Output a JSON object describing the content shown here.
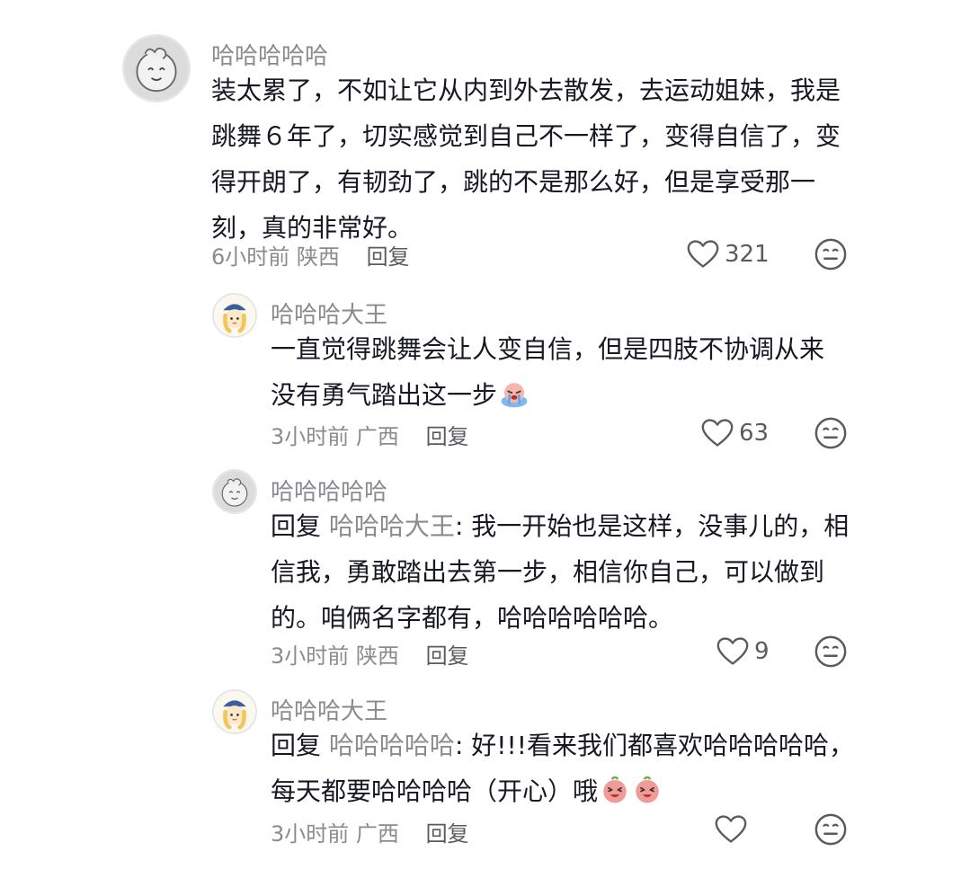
{
  "comments": [
    {
      "username": "哈哈哈哈哈",
      "lines": [
        "装太累了，不如让它从内到外去散发，去运动姐妹，我是",
        "跳舞６年了，切实感觉到自己不一样了，变得自信了，变",
        "得开朗了，有韧劲了，跳的不是那么好，但是享受那一",
        "刻，真的非常好。"
      ],
      "time": "6小时前",
      "location": "陕西",
      "reply_label": "回复",
      "likes": "321"
    },
    {
      "username": "哈哈哈大王",
      "lines": [
        "一直觉得跳舞会让人变自信，但是四肢不协调从来",
        "没有勇气踏出这一步"
      ],
      "time": "3小时前",
      "location": "广西",
      "reply_label": "回复",
      "likes": "63"
    },
    {
      "username": "哈哈哈哈哈",
      "reply_prefix": "回复",
      "mention": "哈哈哈大王",
      "lines": [
        ": 我一开始也是这样，没事儿的，相",
        "信我，勇敢踏出去第一步，相信你自己，可以做到",
        "的。咱俩名字都有，哈哈哈哈哈哈。"
      ],
      "time": "3小时前",
      "location": "陕西",
      "reply_label": "回复",
      "likes": "9"
    },
    {
      "username": "哈哈哈大王",
      "reply_prefix": "回复",
      "mention": "哈哈哈哈哈",
      "lines": [
        ": 好!!!看来我们都喜欢哈哈哈哈哈，",
        "每天都要哈哈哈哈（开心）哦"
      ],
      "time": "3小时前",
      "location": "广西",
      "reply_label": "回复",
      "likes": ""
    }
  ],
  "icons": {
    "like": "heart-outline-icon",
    "dislike": "neutral-face-icon",
    "crying": "crying-emoji",
    "happy": "laughing-emoji"
  },
  "colors": {
    "username": "#8a8b91",
    "text": "#161823",
    "meta": "#8a8b91"
  }
}
